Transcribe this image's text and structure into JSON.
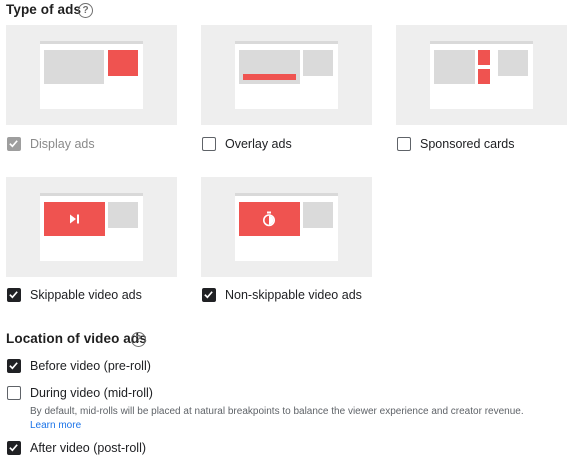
{
  "ad_types": {
    "title": "Type of ads",
    "help_icon": "question-mark-circle-icon",
    "options": [
      {
        "key": "display",
        "label": "Display ads",
        "checked": true,
        "disabled": true
      },
      {
        "key": "overlay",
        "label": "Overlay ads",
        "checked": false,
        "disabled": false
      },
      {
        "key": "sponsored",
        "label": "Sponsored cards",
        "checked": false,
        "disabled": false
      },
      {
        "key": "skippable",
        "label": "Skippable video ads",
        "checked": true,
        "disabled": false,
        "glyph": "skip-icon"
      },
      {
        "key": "nonskippable",
        "label": "Non-skippable video ads",
        "checked": true,
        "disabled": false,
        "glyph": "stopwatch-icon"
      }
    ]
  },
  "video_locations": {
    "title": "Location of video ads",
    "help_icon": "question-mark-circle-icon",
    "options": [
      {
        "key": "preroll",
        "label": "Before video (pre-roll)",
        "checked": true
      },
      {
        "key": "midroll",
        "label": "During video (mid-roll)",
        "checked": false,
        "hint": "By default, mid-rolls will be placed at natural breakpoints to balance the viewer experience and creator revenue.",
        "link": "Learn more"
      },
      {
        "key": "postroll",
        "label": "After video (post-roll)",
        "checked": true
      }
    ]
  },
  "colors": {
    "accent_red": "#ef5350",
    "card_bg": "#eeeeee",
    "link_blue": "#1a73e8",
    "checkbox_checked": "#202124",
    "checkbox_disabled": "#9e9e9e"
  }
}
